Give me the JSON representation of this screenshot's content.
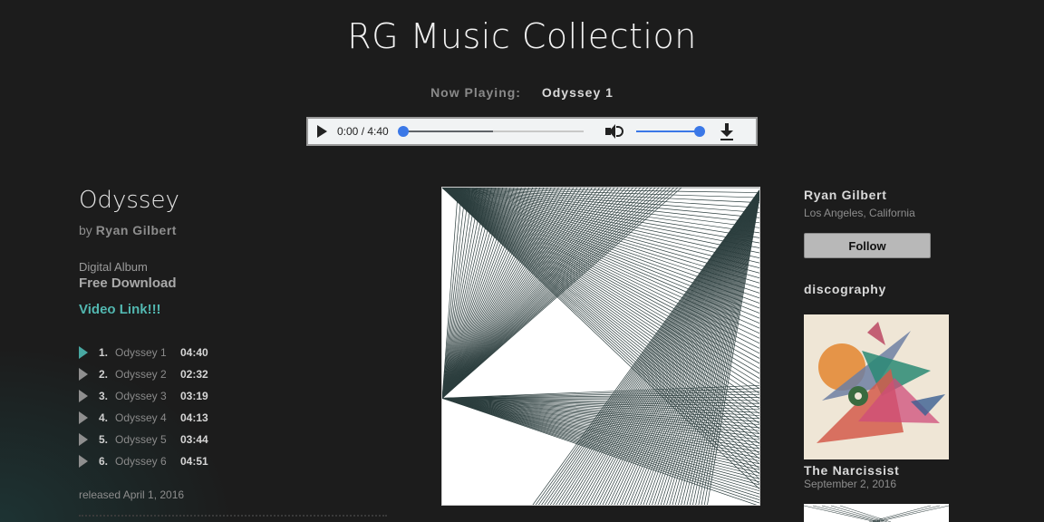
{
  "header": {
    "site_title": "RG Music Collection",
    "now_playing_label": "Now Playing:",
    "now_playing_track": "Odyssey 1"
  },
  "player": {
    "time_display": "0:00 / 4:40",
    "buffered_fraction": 0.5,
    "volume_fraction": 1.0,
    "icons": [
      "play-icon",
      "volume-icon",
      "download-icon"
    ]
  },
  "album": {
    "title": "Odyssey",
    "by_label": "by",
    "artist": "Ryan Gilbert",
    "format": "Digital Album",
    "free_download": "Free Download",
    "video_link": "Video Link!!!",
    "released": "released April 1, 2016",
    "tracks": [
      {
        "num": "1.",
        "name": "Odyssey 1",
        "duration": "04:40",
        "active": true
      },
      {
        "num": "2.",
        "name": "Odyssey 2",
        "duration": "02:32",
        "active": false
      },
      {
        "num": "3.",
        "name": "Odyssey 3",
        "duration": "03:19",
        "active": false
      },
      {
        "num": "4.",
        "name": "Odyssey 4",
        "duration": "04:13",
        "active": false
      },
      {
        "num": "5.",
        "name": "Odyssey 5",
        "duration": "03:44",
        "active": false
      },
      {
        "num": "6.",
        "name": "Odyssey 6",
        "duration": "04:51",
        "active": false
      }
    ]
  },
  "sidebar": {
    "artist_name": "Ryan Gilbert",
    "location": "Los Angeles, California",
    "follow_label": "Follow",
    "discography_heading": "discography",
    "discography": [
      {
        "title": "The Narcissist",
        "date": "September 2, 2016"
      }
    ]
  },
  "colors": {
    "background": "#1c1c1c",
    "accent_teal": "#52b7b0",
    "player_blue": "#3b78e7"
  }
}
